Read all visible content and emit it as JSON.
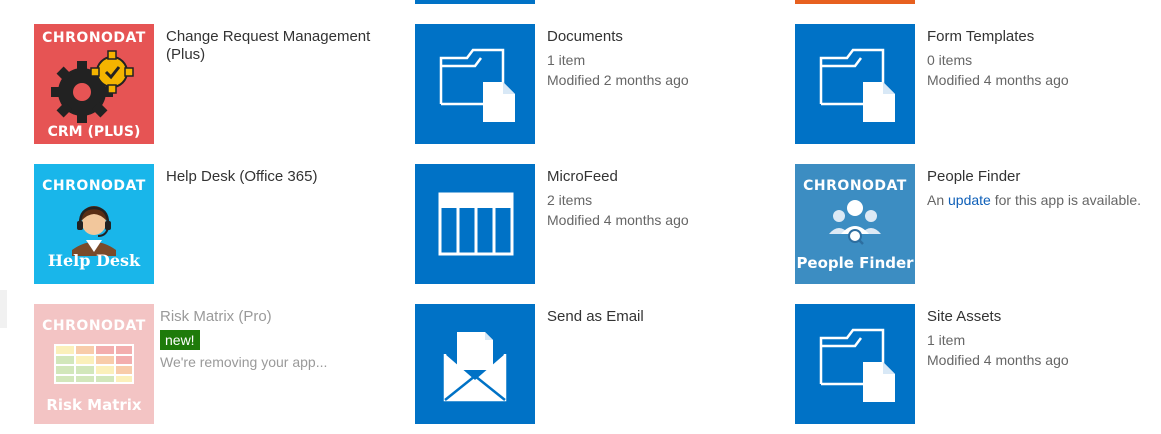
{
  "colors": {
    "tile_blue": "#0072c6",
    "crm_red": "#e65454",
    "helpdesk_cyan": "#19b6ea",
    "peoplefinder_steel": "#3c8dc2",
    "riskmatrix_pink": "#e88a8a",
    "new_badge_green": "#1e7b0a",
    "link_blue": "#0e5fb8",
    "top_orange": "#e7601f"
  },
  "apps": [
    {
      "title": "Change Request Management (Plus)",
      "thumb_brand": "CHRONODAT",
      "thumb_caption": "CRM (PLUS)",
      "icon": "gears-check-icon"
    },
    {
      "title": "Documents",
      "meta1": "1 item",
      "meta2": "Modified 2 months ago",
      "icon": "folder-document-icon"
    },
    {
      "title": "Form Templates",
      "meta1": "0 items",
      "meta2": "Modified 4 months ago",
      "icon": "folder-document-icon"
    },
    {
      "title": "Help Desk (Office 365)",
      "thumb_brand": "CHRONODAT",
      "thumb_caption": "Help Desk",
      "icon": "headset-agent-icon"
    },
    {
      "title": "MicroFeed",
      "meta1": "2 items",
      "meta2": "Modified 4 months ago",
      "icon": "list-table-icon"
    },
    {
      "title": "People Finder",
      "meta_prefix": "An",
      "meta_link": "update",
      "meta_suffix": "for this app is available.",
      "thumb_brand": "CHRONODAT",
      "thumb_caption": "People Finder",
      "icon": "people-search-icon"
    },
    {
      "title": "Risk Matrix (Pro)",
      "badge": "new!",
      "meta1": "We're removing your app...",
      "thumb_brand": "CHRONODAT",
      "thumb_caption": "Risk Matrix",
      "icon": "risk-grid-icon"
    },
    {
      "title": "Send as Email",
      "icon": "envelope-document-icon"
    },
    {
      "title": "Site Assets",
      "meta1": "1 item",
      "meta2": "Modified 4 months ago",
      "icon": "folder-document-icon"
    }
  ]
}
